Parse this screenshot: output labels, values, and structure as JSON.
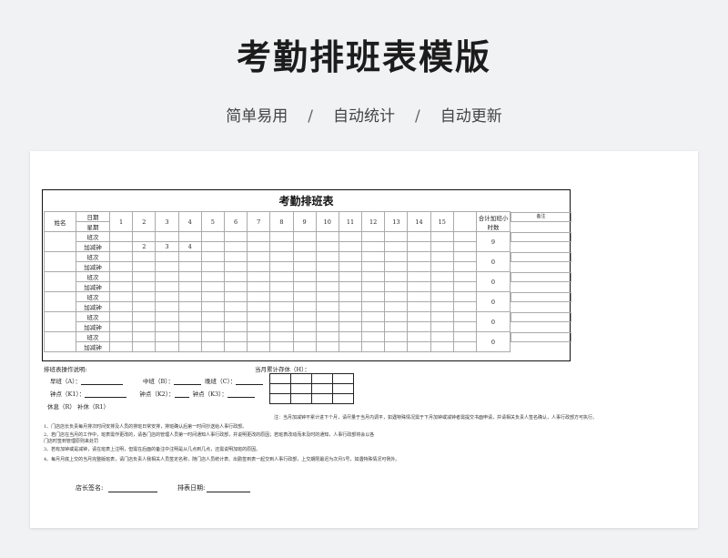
{
  "header": {
    "title": "考勤排班表模版",
    "features": [
      "简单易用",
      "自动统计",
      "自动更新"
    ],
    "separator": "/"
  },
  "sheet": {
    "title": "考勤排班表",
    "col_name": "姓名",
    "col_date": "日期",
    "col_week": "星期",
    "days": [
      "1",
      "2",
      "3",
      "4",
      "5",
      "6",
      "7",
      "8",
      "9",
      "10",
      "11",
      "12",
      "13",
      "14",
      "15"
    ],
    "col_total": "合计加班小时数",
    "col_remark": "备注",
    "row_shift": "班次",
    "row_overtime": "加减钟",
    "employees": [
      {
        "name": "",
        "overtime": [
          "",
          "2",
          "3",
          "4",
          "",
          "",
          "",
          "",
          "",
          "",
          "",
          "",
          "",
          "",
          ""
        ],
        "total": "9"
      },
      {
        "name": "",
        "overtime": [
          "",
          "",
          "",
          "",
          "",
          "",
          "",
          "",
          "",
          "",
          "",
          "",
          "",
          "",
          ""
        ],
        "total": "0"
      },
      {
        "name": "",
        "overtime": [
          "",
          "",
          "",
          "",
          "",
          "",
          "",
          "",
          "",
          "",
          "",
          "",
          "",
          "",
          ""
        ],
        "total": "0"
      },
      {
        "name": "",
        "overtime": [
          "",
          "",
          "",
          "",
          "",
          "",
          "",
          "",
          "",
          "",
          "",
          "",
          "",
          "",
          ""
        ],
        "total": "0"
      },
      {
        "name": "",
        "overtime": [
          "",
          "",
          "",
          "",
          "",
          "",
          "",
          "",
          "",
          "",
          "",
          "",
          "",
          "",
          ""
        ],
        "total": "0"
      },
      {
        "name": "",
        "overtime": [
          "",
          "",
          "",
          "",
          "",
          "",
          "",
          "",
          "",
          "",
          "",
          "",
          "",
          "",
          ""
        ],
        "total": "0"
      }
    ]
  },
  "instructions": {
    "heading": "排班表操作说明:",
    "morning": "早班（A）：",
    "middle": "中班（B）：",
    "night": "晚班（C）：",
    "k1": "钟点（K1）：",
    "k2": "钟点（K2）：",
    "k3": "钟点（K3）：",
    "rest": "休息（R） 补休（R1）",
    "accum_heading": "当月累计存休（H）：",
    "accum_note": "注：当月加减钟不累计进下个月，请尽量于当月内调平，如遇特殊情况需于下月加钟或减钟者需提交书面申请，并请相关负责人签名确认，人事行政部方可执行。",
    "rules": [
      "1、门店店长负责每月排次时间安排及人员的排班日常安排，排班确认后第一时间抄送给人事行政部。",
      "2、若门店在当月的工作中，班表需作更改的，请各门店的管理人员第一时间通知人事行政部，并说明更改的原因；若班表改动而未及时的通知，人事行政部将会以各",
      "门店时签到管理原则来处罚",
      "3、若有加钟或是减钟，请在班表上注明，但需在后面的备注中注明是从几点到几点，还需说明加班的原因。",
      "4、每月月底上交的当月完整版班表，请门店负责人我相关人员签定名称，随门店人员统计表、出勤签到表一起交到人事行政部，上交期限最迟为次月5号，如遇特殊情况可例外。"
    ]
  },
  "signatures": {
    "manager": "店长签名:",
    "scheduler": "排表日期:"
  }
}
